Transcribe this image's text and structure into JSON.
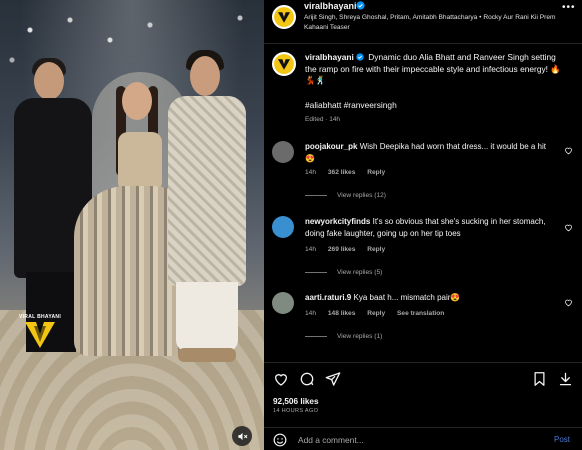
{
  "post": {
    "username": "viralbhayani",
    "audio": "Arijit Singh, Shreya Ghoshal, Pritam, Amitabh Bhattacharya • Rocky Aur Rani Kii Prem Kahaani Teaser",
    "more_label": "•••",
    "watermark_text": "VIRAL BHAYANI"
  },
  "caption": {
    "username": "viralbhayani",
    "text": "Dynamic duo Alia Bhatt and Ranveer Singh setting the ramp on fire with their impeccable style and infectious energy! 🔥💃🕺",
    "hashtags": "#aliabhatt #ranveersingh",
    "meta": "Edited · 14h"
  },
  "comments": [
    {
      "username": "poojakour_pk",
      "text": "Wish Deepika had worn that dress... it would be a hit 😍",
      "time": "14h",
      "likes": "362 likes",
      "reply": "Reply",
      "translate": "",
      "view_replies": "View replies (12)",
      "avatar_color": "#6b6b6b"
    },
    {
      "username": "newyorkcityfinds",
      "text": "It's so obvious that she's sucking in her stomach, doing fake laughter, going up on her tip toes",
      "time": "14h",
      "likes": "269 likes",
      "reply": "Reply",
      "translate": "",
      "view_replies": "View replies (5)",
      "avatar_color": "#3a8fd0"
    },
    {
      "username": "aarti.raturi.9",
      "text": "Kya baat h... mismatch pair😍",
      "time": "14h",
      "likes": "148 likes",
      "reply": "Reply",
      "translate": "See translation",
      "view_replies": "View replies (1)",
      "avatar_color": "#7f8a80"
    }
  ],
  "actions": {
    "likes": "92,506 likes",
    "time_ago": "14 HOURS AGO",
    "comment_placeholder": "Add a comment...",
    "post_label": "Post"
  },
  "colors": {
    "accent": "#0095f6",
    "brand_yellow": "#f3c614",
    "background": "#000000",
    "muted_text": "#a8a8a8"
  },
  "icons": [
    "verified-badge-icon",
    "more-icon",
    "heart-icon",
    "comment-icon",
    "share-icon",
    "bookmark-icon",
    "download-icon",
    "emoji-icon",
    "mute-icon",
    "viral-bhayani-logo"
  ]
}
